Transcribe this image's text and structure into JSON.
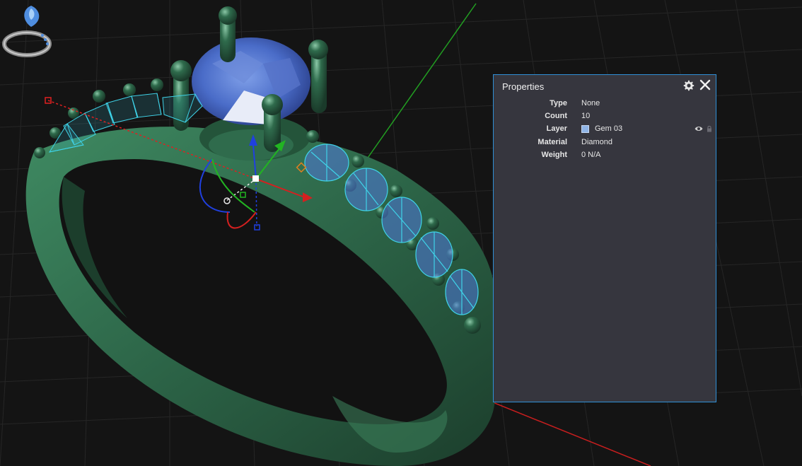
{
  "panel": {
    "title": "Properties",
    "rows": [
      {
        "label": "Type",
        "value": "None"
      },
      {
        "label": "Count",
        "value": "10"
      },
      {
        "label": "Layer",
        "value": "Gem 03"
      },
      {
        "label": "Material",
        "value": "Diamond"
      },
      {
        "label": "Weight",
        "value": "0 N/A"
      }
    ],
    "layer_color": "#8fb4e6"
  },
  "icons": {
    "gear": "gear-icon",
    "close": "close-icon",
    "eye": "eye-icon",
    "lock": "lock-icon"
  },
  "colors": {
    "accent": "#2f8fd6",
    "ring_metal": "#2f6b4c",
    "gem_wireframe": "#3fd3e8",
    "center_stone": "#4a6cc8",
    "axis_x": "#d42020",
    "axis_y": "#22b422",
    "axis_z": "#2040e0"
  }
}
